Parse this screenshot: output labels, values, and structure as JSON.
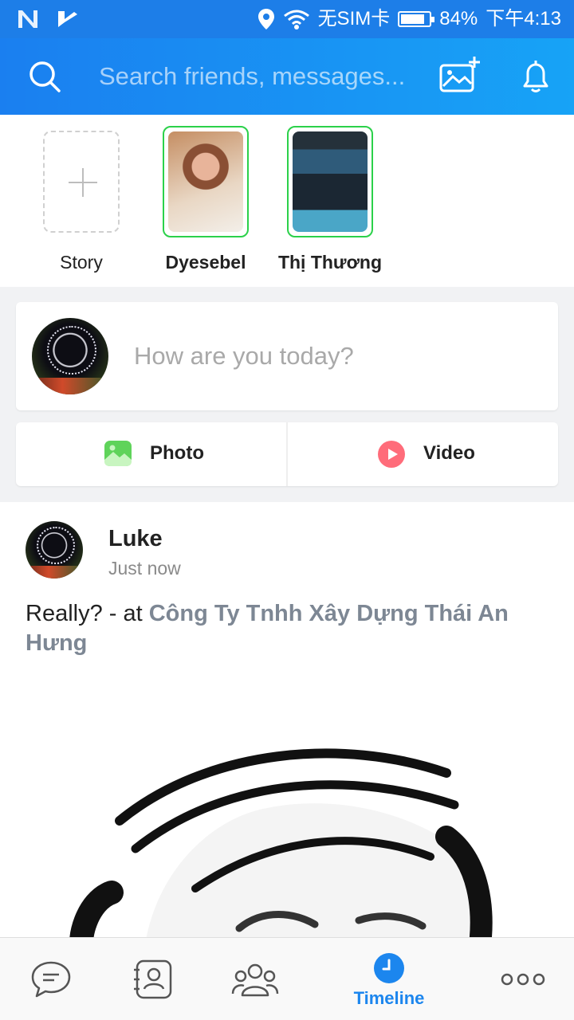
{
  "status_bar": {
    "sim_text": "无SIM卡",
    "battery": "84%",
    "battery_level": 0.84,
    "time": "下午4:13",
    "left_icons": [
      "n-icon",
      "check-icon"
    ]
  },
  "header": {
    "search_placeholder": "Search friends, messages...",
    "icons": [
      "search-icon",
      "add-photo-icon",
      "bell-icon"
    ]
  },
  "stories": {
    "items": [
      {
        "label": "Story",
        "type": "add"
      },
      {
        "label": "Dyesebel",
        "type": "friend"
      },
      {
        "label": "Thị Thương",
        "type": "friend"
      }
    ]
  },
  "composer": {
    "placeholder": "How are you today?",
    "photo_label": "Photo",
    "video_label": "Video"
  },
  "post": {
    "author": "Luke",
    "time": "Just now",
    "text": "Really? - at ",
    "location": "Công Ty Tnhh Xây Dựng Thái An Hưng"
  },
  "bottom_nav": {
    "items": [
      {
        "icon": "chat-icon",
        "label": ""
      },
      {
        "icon": "contacts-icon",
        "label": ""
      },
      {
        "icon": "group-icon",
        "label": ""
      },
      {
        "icon": "clock-icon",
        "label": "Timeline",
        "active": true
      },
      {
        "icon": "more-icon",
        "label": ""
      }
    ],
    "active_color": "#1c86ee"
  },
  "colors": {
    "header_start": "#1a7ff0",
    "header_end": "#17a3f6",
    "story_ring": "#2bd14a"
  }
}
